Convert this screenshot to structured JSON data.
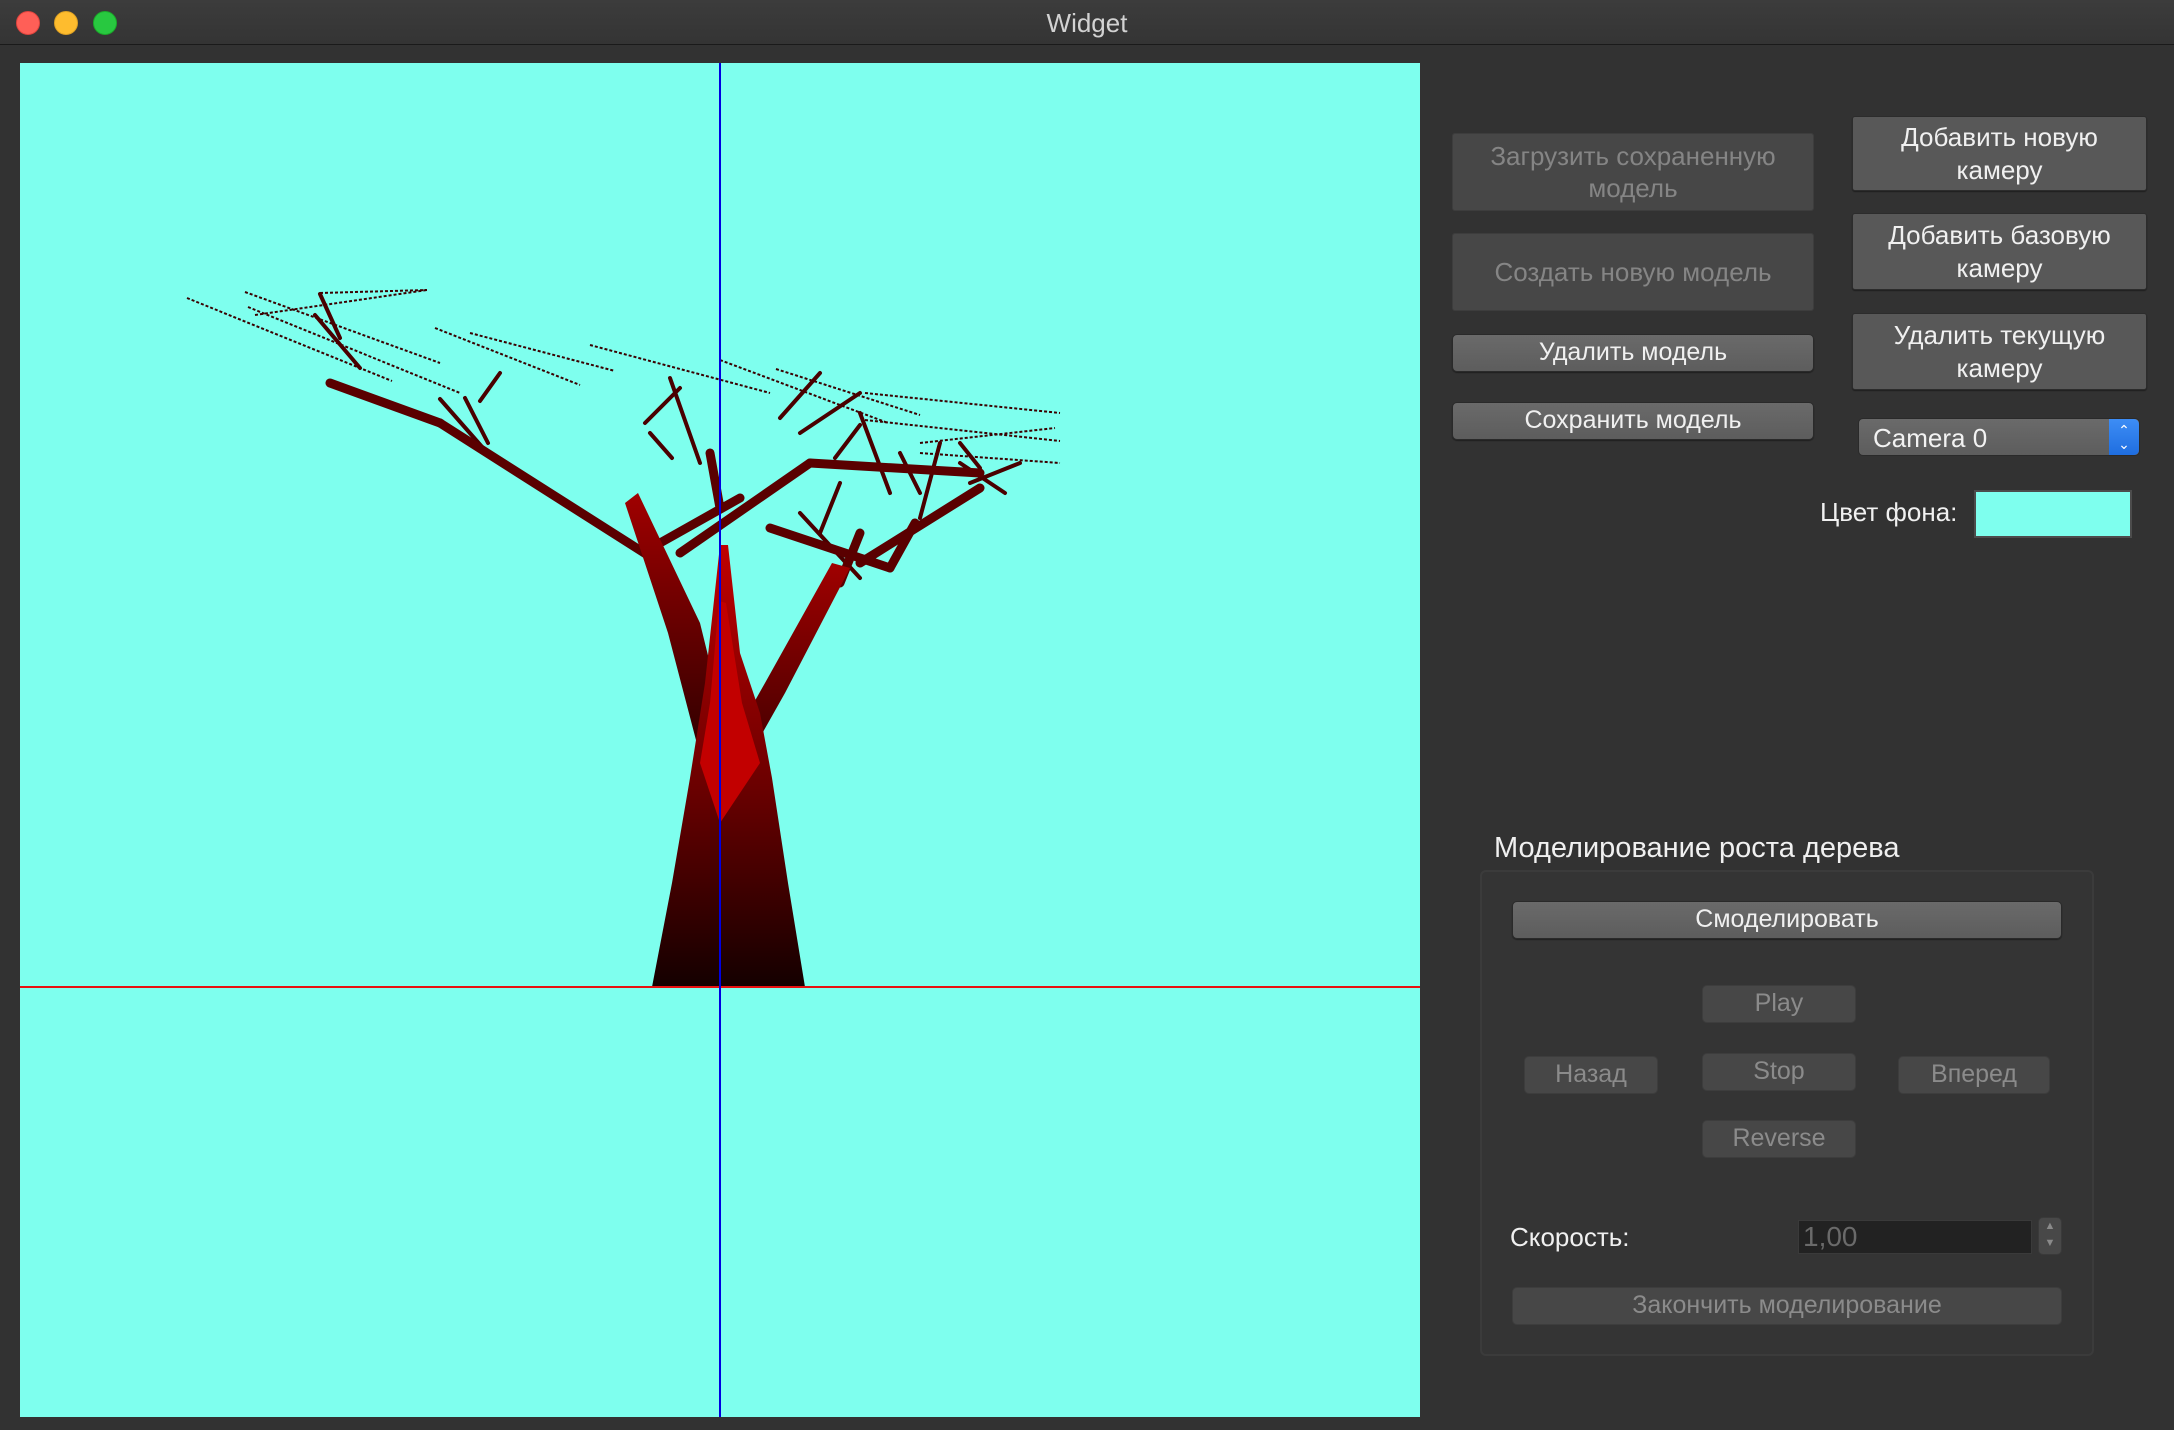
{
  "window": {
    "title": "Widget"
  },
  "colors": {
    "viewport_bg": "#7effee",
    "trunk": "#b30000",
    "x_axis": "#e81010",
    "y_axis": "#0000e0",
    "select_accent": "#2f7ef0"
  },
  "left_buttons": {
    "load_model": "Загрузить сохраненную модель",
    "new_model": "Создать новую модель",
    "delete_model": "Удалить модель",
    "save_model": "Сохранить модель"
  },
  "camera": {
    "add_new": "Добавить новую камеру",
    "add_base": "Добавить базовую камеру",
    "delete_current": "Удалить текущую камеру",
    "selected": "Camera 0"
  },
  "background": {
    "label": "Цвет фона:",
    "color": "#7effee"
  },
  "growth": {
    "title": "Моделирование роста дерева",
    "simulate": "Смоделировать",
    "play": "Play",
    "back": "Назад",
    "stop": "Stop",
    "forward": "Вперед",
    "reverse": "Reverse",
    "speed_label": "Скорость:",
    "speed_value": "1,00",
    "finish": "Закончить моделирование"
  }
}
